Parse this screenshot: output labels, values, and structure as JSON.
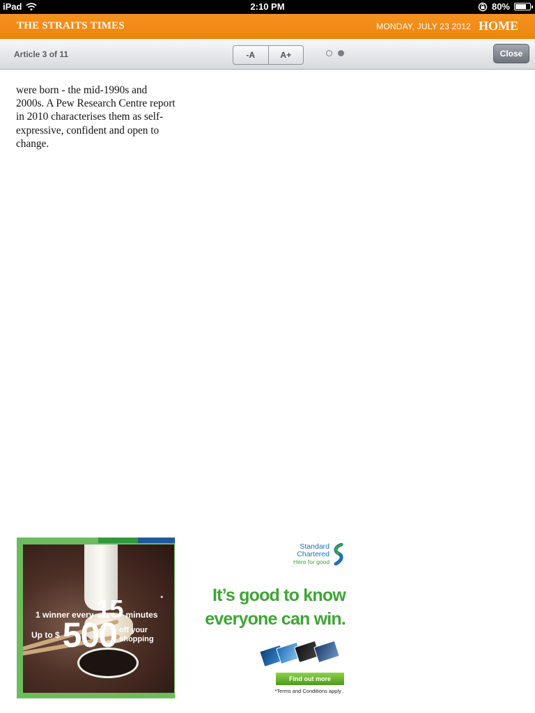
{
  "status_bar": {
    "device": "iPad",
    "time": "2:10 PM",
    "battery": "80%",
    "battery_level": 0.8
  },
  "masthead": {
    "brand": "THE STRAITS TIMES",
    "date": "MONDAY, JULY 23 2012",
    "home": "HOME"
  },
  "toolbar": {
    "article_counter": "Article 3 of 11",
    "font_decrease": "-A",
    "font_increase": "A+",
    "close": "Close",
    "pages": [
      {
        "state": "empty"
      },
      {
        "state": "current"
      }
    ]
  },
  "article": {
    "body": "were born - the mid-1990s and 2000s. A Pew Research Centre report in 2010 characterises them as self-expressive, confident and open to change."
  },
  "ad": {
    "advertiser": "Standard Chartered",
    "tagline": "Here for good",
    "line1_prefix": "1 winner every",
    "line1_number": "15",
    "line1_suffix": "minutes",
    "line1_mark": "*",
    "line2_prefix": "Up to $",
    "line2_number": "500",
    "line2_suffix": "off your shopping",
    "headline_1": "It’s good to know",
    "headline_2": "everyone can win.",
    "cta": "Find out more",
    "terms": "*Terms and Conditions apply .",
    "colors": {
      "green": "#3fa535",
      "blue": "#1d6fb8",
      "border_green": "#6dbb5f",
      "strip": [
        "#6dbb5f",
        "#2e9a3c",
        "#1f5a9a"
      ]
    }
  },
  "colors": {
    "masthead": "#f28c18",
    "toolbar_text": "#5a5e66",
    "close_button": "#8a8f97"
  }
}
